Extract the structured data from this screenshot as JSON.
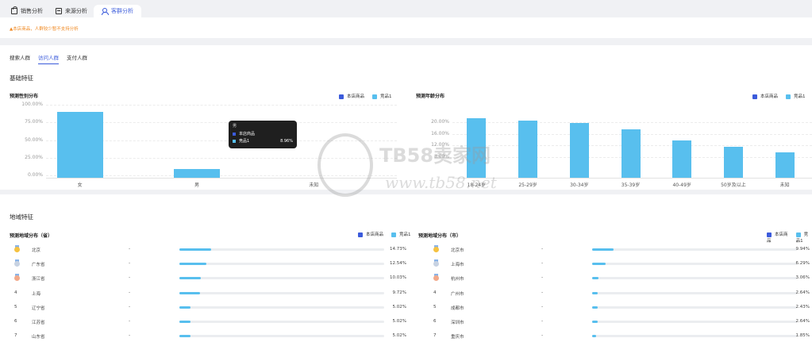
{
  "tabs": [
    {
      "label": "销售分析",
      "icon": "bag-icon",
      "active": false
    },
    {
      "label": "来源分析",
      "icon": "box-icon",
      "active": false
    },
    {
      "label": "客群分析",
      "icon": "users-icon",
      "active": true
    }
  ],
  "notice": "▲本店商品，人群较少暂不支持分析",
  "subtabs": [
    {
      "label": "搜索人群",
      "active": false
    },
    {
      "label": "访问人群",
      "active": true
    },
    {
      "label": "支付人群",
      "active": false
    }
  ],
  "basic_title": "基础特征",
  "region_title": "地域特征",
  "legend": {
    "own": "本店商品",
    "competitor": "竞品1"
  },
  "colors": {
    "own": "#3b5bdb",
    "competitor": "#58bfee",
    "accent": "#3b5bdb",
    "notice": "#f08a24"
  },
  "tooltip": {
    "header": "男",
    "own_label": "本店商品",
    "comp_label": "竞品1",
    "comp_value": "8.96%"
  },
  "watermark": {
    "brand": "TB58卖家网",
    "url": "www.tb58.net"
  },
  "chart_data": [
    {
      "type": "bar",
      "title": "预测性别分布",
      "categories": [
        "女",
        "男",
        "未知"
      ],
      "yticks": [
        "100.00%",
        "75.00%",
        "50.00%",
        "25.00%",
        "0.00%"
      ],
      "ylim": [
        0,
        100
      ],
      "series": [
        {
          "name": "本店商品",
          "values": [
            0,
            0,
            0
          ]
        },
        {
          "name": "竞品1",
          "values": [
            89.6,
            8.96,
            0
          ]
        }
      ]
    },
    {
      "type": "bar",
      "title": "预测年龄分布",
      "categories": [
        "18-24岁",
        "25-29岁",
        "30-34岁",
        "35-39岁",
        "40-49岁",
        "50岁及以上",
        "未知"
      ],
      "yticks": [
        "20.00%",
        "16.00%",
        "12.00%",
        "8.00%"
      ],
      "ylim": [
        8,
        20
      ],
      "series": [
        {
          "name": "本店商品",
          "values": [
            0,
            0,
            0,
            0,
            0,
            0,
            0
          ]
        },
        {
          "name": "竞品1",
          "values": [
            21.4,
            20.6,
            19.6,
            17.6,
            13.6,
            11.6,
            9.7
          ]
        }
      ]
    }
  ],
  "province": {
    "title": "预测地域分布（省）",
    "rows": [
      {
        "rank": "1",
        "name": "北京",
        "own": "-",
        "value": 14.73,
        "pct": "14.73%"
      },
      {
        "rank": "2",
        "name": "广东省",
        "own": "-",
        "value": 12.54,
        "pct": "12.54%"
      },
      {
        "rank": "3",
        "name": "浙江省",
        "own": "-",
        "value": 10.03,
        "pct": "10.03%"
      },
      {
        "rank": "4",
        "name": "上海",
        "own": "-",
        "value": 9.72,
        "pct": "9.72%"
      },
      {
        "rank": "5",
        "name": "辽宁省",
        "own": "-",
        "value": 5.02,
        "pct": "5.02%"
      },
      {
        "rank": "6",
        "name": "江苏省",
        "own": "-",
        "value": 5.02,
        "pct": "5.02%"
      },
      {
        "rank": "7",
        "name": "山东省",
        "own": "-",
        "value": 5.02,
        "pct": "5.02%"
      }
    ]
  },
  "city": {
    "title": "预测地域分布（市）",
    "rows": [
      {
        "rank": "1",
        "name": "北京市",
        "own": "-",
        "value": 9.94,
        "pct": "9.94%"
      },
      {
        "rank": "2",
        "name": "上海市",
        "own": "-",
        "value": 6.29,
        "pct": "6.29%"
      },
      {
        "rank": "3",
        "name": "杭州市",
        "own": "-",
        "value": 3.06,
        "pct": "3.06%"
      },
      {
        "rank": "4",
        "name": "广州市",
        "own": "-",
        "value": 2.64,
        "pct": "2.64%"
      },
      {
        "rank": "5",
        "name": "成都市",
        "own": "-",
        "value": 2.43,
        "pct": "2.43%"
      },
      {
        "rank": "6",
        "name": "深圳市",
        "own": "-",
        "value": 2.64,
        "pct": "2.64%"
      },
      {
        "rank": "7",
        "name": "重庆市",
        "own": "-",
        "value": 1.85,
        "pct": "1.85%"
      }
    ]
  }
}
